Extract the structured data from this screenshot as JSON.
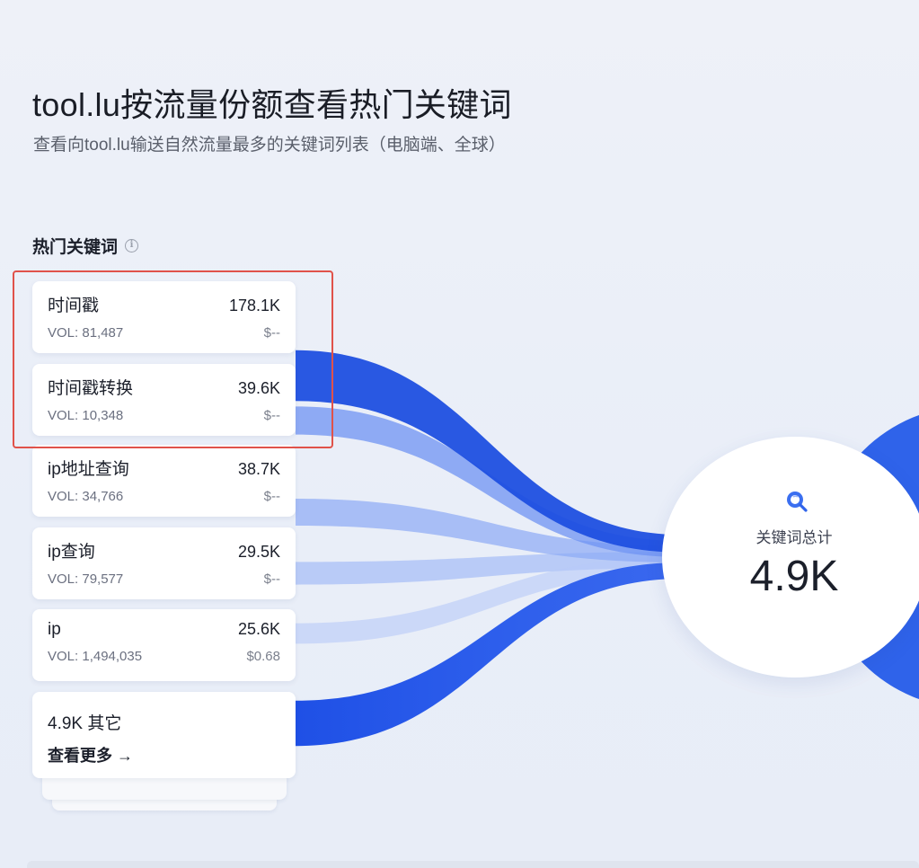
{
  "header": {
    "title": "tool.lu按流量份额查看热门关键词",
    "subtitle": "查看向tool.lu输送自然流量最多的关键词列表（电脑端、全球）"
  },
  "section": {
    "title": "热门关键词",
    "info_icon": "info-icon"
  },
  "keywords": [
    {
      "name": "时间戳",
      "traffic": "178.1K",
      "volume": "VOL: 81,487",
      "cpc": "$--",
      "flow_share": 0.47
    },
    {
      "name": "时间戳转换",
      "traffic": "39.6K",
      "volume": "VOL: 10,348",
      "cpc": "$--",
      "flow_share": 0.26
    },
    {
      "name": "ip地址查询",
      "traffic": "38.7K",
      "volume": "VOL: 34,766",
      "cpc": "$--",
      "flow_share": 0.25
    },
    {
      "name": "ip查询",
      "traffic": "29.5K",
      "volume": "VOL: 79,577",
      "cpc": "$--",
      "flow_share": 0.21
    },
    {
      "name": "ip",
      "traffic": "25.6K",
      "volume": "VOL: 1,494,035",
      "cpc": "$0.68",
      "flow_share": 0.19
    }
  ],
  "other": {
    "label": "4.9K 其它",
    "link": "查看更多 →",
    "flow_share": 0.42
  },
  "total": {
    "icon": "search-icon",
    "label": "关键词总计",
    "value": "4.9K"
  },
  "colors": {
    "flow_dark": "#1f4fe0",
    "flow_mid": "#4f7bf0",
    "flow_light": "#a9bff6",
    "accent_circle": "#2f63ea",
    "highlight": "#e0524a"
  }
}
